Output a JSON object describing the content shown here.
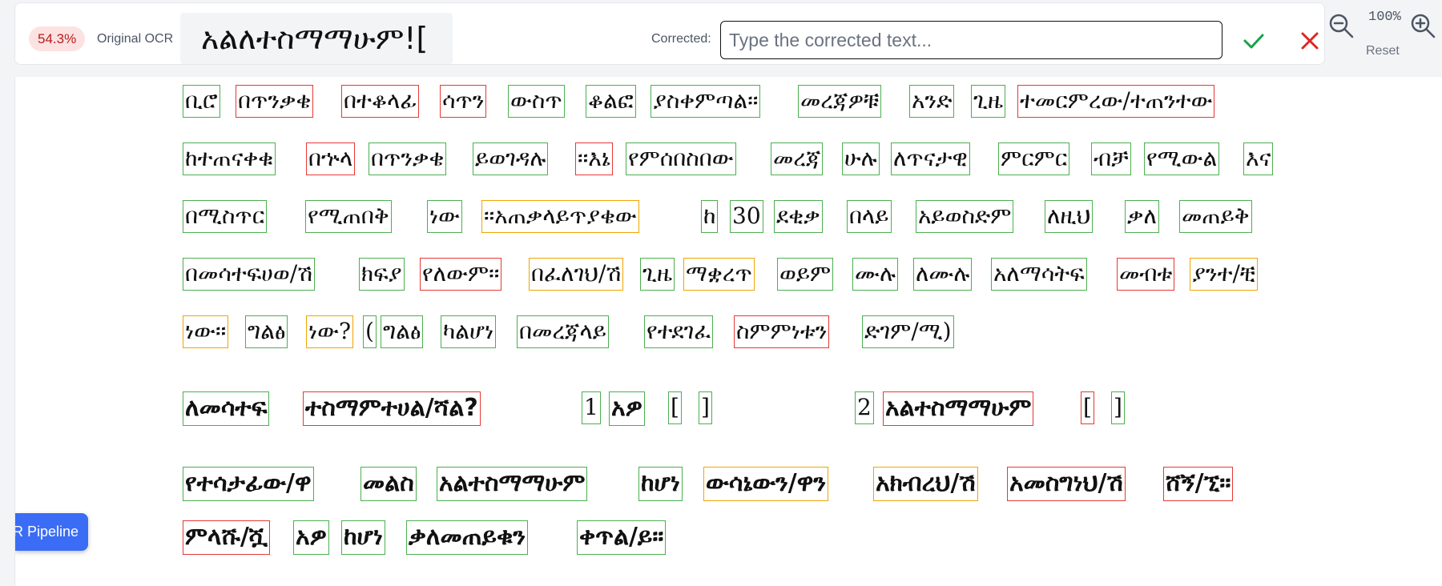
{
  "ocr_bar": {
    "confidence": "54.3%",
    "original_label": "Original OCR",
    "original_text": "አልለተስማማሁም![",
    "corrected_label": "Corrected:",
    "corrected_placeholder": "Type the corrected text...",
    "corrected_value": ""
  },
  "zoom": {
    "level": "100%",
    "reset_label": "Reset"
  },
  "pipeline_button": {
    "label": "OCR Pipeline"
  },
  "document": {
    "lines": [
      [
        "ቢሮ",
        "በጥንቃቄ",
        "በተቆላፊ",
        "ሳጥን",
        "ውስጥ",
        "ቆልፎ",
        "ያስቀምጣል፡፡",
        "መረጃዎቹ",
        "አንድ",
        "ጊዜ",
        "ተመርምረው/ተጠንተው"
      ],
      [
        "ከተጠናቀቁ",
        "በኍላ",
        "በጥንቃቄ",
        "ይወገዳሉ",
        "፡፡እኔ",
        "የምሰበስበው",
        "መረጃ",
        "ሁሉ",
        "ለጥናታዊ",
        "ምርምር",
        "ብቻ",
        "የሚውል",
        "እና"
      ],
      [
        "በሚስጥር",
        "የሚጠበቅ",
        "ነው",
        "፡፡አጠቃላይጥያቄው",
        "ከ",
        "30",
        "ደቂቃ",
        "በላይ",
        "አይወስድም",
        "ለዚህ",
        "ቃለ",
        "መጠይቅ"
      ],
      [
        "በመሳተፍሀወ/ሽ",
        "ክፍያ",
        "የለውም፡፡",
        "በፈለገህ/ሽ",
        "ጊዜ",
        "ማቋረጥ",
        "ወይም",
        "ሙሉ",
        "ለሙሉ",
        "አለማሳትፍ",
        "መብቱ",
        "ያንተ/ቺ"
      ],
      [
        "ነው፡፡",
        "ግልፅ",
        "ነው?",
        "(",
        "ግልፅ",
        "ካልሆነ",
        "በመረጃላይ",
        "የተደገፈ",
        "ስምምነቱን",
        "ድገም/ሚ)"
      ],
      [
        "ለመሳተፍ",
        "ተስማምተሀል/ሻል?",
        "1",
        "አዎ",
        "[",
        "]",
        "2",
        "አልተስማማሁም",
        "[",
        "]"
      ],
      [
        "የተሳታፊው/ዋ",
        "መልስ",
        "አልተስማማሁም",
        "ከሆነ",
        "ውሳኔውን/ዋን",
        "አክብረህ/ሽ",
        "አመስግነህ/ሽ",
        "ሸኝ/ኚ፡፡"
      ],
      [
        "ምላሹ/ሿ",
        "አዎ",
        "ከሆነ",
        "ቃለመጠይቁን",
        "ቀጥል/ይ።"
      ]
    ]
  }
}
